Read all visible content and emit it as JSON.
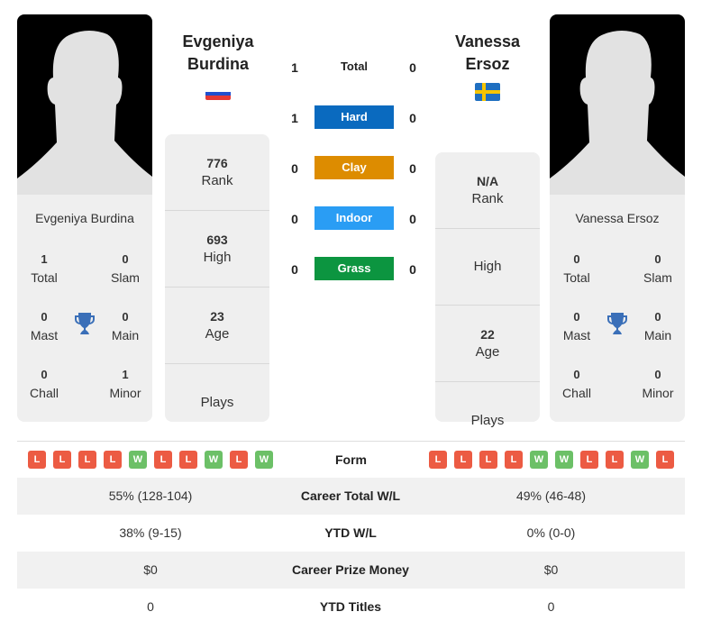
{
  "players": {
    "left": {
      "name": "Evgeniya Burdina",
      "name_line1": "Evgeniya",
      "name_line2": "Burdina",
      "flag": "russia-flag",
      "titles": {
        "total": "1",
        "total_label": "Total",
        "slam": "0",
        "slam_label": "Slam",
        "mast": "0",
        "mast_label": "Mast",
        "main": "0",
        "main_label": "Main",
        "chall": "0",
        "chall_label": "Chall",
        "minor": "1",
        "minor_label": "Minor"
      },
      "stats": {
        "rank": "776",
        "rank_label": "Rank",
        "high": "693",
        "high_label": "High",
        "age": "23",
        "age_label": "Age",
        "plays": "",
        "plays_label": "Plays"
      },
      "form": [
        "L",
        "L",
        "L",
        "L",
        "W",
        "L",
        "L",
        "W",
        "L",
        "W"
      ]
    },
    "right": {
      "name": "Vanessa Ersoz",
      "name_line1": "Vanessa",
      "name_line2": "Ersoz",
      "flag": "sweden-flag",
      "titles": {
        "total": "0",
        "total_label": "Total",
        "slam": "0",
        "slam_label": "Slam",
        "mast": "0",
        "mast_label": "Mast",
        "main": "0",
        "main_label": "Main",
        "chall": "0",
        "chall_label": "Chall",
        "minor": "0",
        "minor_label": "Minor"
      },
      "stats": {
        "rank": "N/A",
        "rank_label": "Rank",
        "high": "",
        "high_label": "High",
        "age": "22",
        "age_label": "Age",
        "plays": "",
        "plays_label": "Plays"
      },
      "form": [
        "L",
        "L",
        "L",
        "L",
        "W",
        "W",
        "L",
        "L",
        "W",
        "L"
      ]
    }
  },
  "h2h": [
    {
      "label": "Total",
      "left": "1",
      "right": "0",
      "color": ""
    },
    {
      "label": "Hard",
      "left": "1",
      "right": "0",
      "color": "#0a6abf"
    },
    {
      "label": "Clay",
      "left": "0",
      "right": "0",
      "color": "#dd8c00"
    },
    {
      "label": "Indoor",
      "left": "0",
      "right": "0",
      "color": "#2a9df4"
    },
    {
      "label": "Grass",
      "left": "0",
      "right": "0",
      "color": "#0c9540"
    }
  ],
  "form_label": "Form",
  "comparison": [
    {
      "label": "Career Total W/L",
      "left": "55% (128-104)",
      "right": "49% (46-48)"
    },
    {
      "label": "YTD W/L",
      "left": "38% (9-15)",
      "right": "0% (0-0)"
    },
    {
      "label": "Career Prize Money",
      "left": "$0",
      "right": "$0"
    },
    {
      "label": "YTD Titles",
      "left": "0",
      "right": "0"
    }
  ],
  "colors": {
    "loss": "#ec5b43",
    "win": "#6cc067",
    "trophy": "#3a6fb8"
  }
}
